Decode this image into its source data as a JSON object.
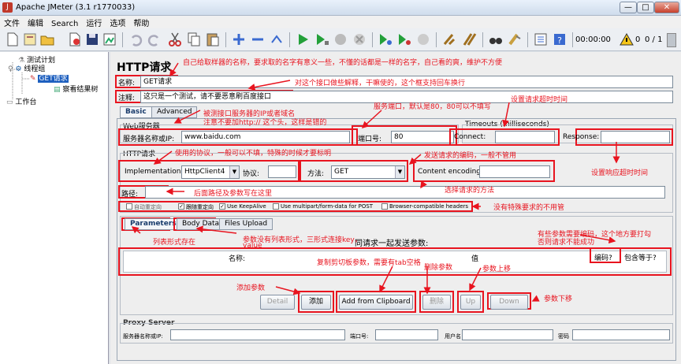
{
  "window": {
    "title": "Apache JMeter (3.1 r1770033)"
  },
  "menu": [
    "文件",
    "编辑",
    "Search",
    "运行",
    "选项",
    "帮助"
  ],
  "toolbar": {
    "time": "00:00:00",
    "warn_count": "0",
    "ratio": "0 / 1"
  },
  "tree": {
    "plan": "测试计划",
    "group": "线程组",
    "sampler": "GET请求",
    "listener": "察看结果树",
    "workbench": "工作台"
  },
  "http": {
    "title": "HTTP请求",
    "name_label": "名称:",
    "name_value": "GET请求",
    "comment_label": "注释:",
    "comment_value": "这只是一个测试，请不要恶意刷百度接口",
    "tab_basic": "Basic",
    "tab_advanced": "Advanced",
    "web_server": "Web服务器",
    "server_label": "服务器名称或IP:",
    "server_value": "www.baidu.com",
    "port_label": "端口号:",
    "port_value": "80",
    "timeouts_title": "Timeouts (milliseconds)",
    "connect_label": "Connect:",
    "response_label": "Response:",
    "http_request": "HTTP请求",
    "impl_label": "Implementation:",
    "impl_value": "HttpClient4",
    "protocol_label": "协议:",
    "method_label": "方法:",
    "method_value": "GET",
    "encoding_label": "Content encoding:",
    "path_label": "路径:",
    "options": [
      "自动重定向",
      "跟随重定向",
      "Use KeepAlive",
      "Use multipart/form-data for POST",
      "Browser-compatible headers"
    ],
    "sub_tabs": [
      "Parameters",
      "Body Data",
      "Files Upload"
    ],
    "send_params": "同请求一起发送参数:",
    "col_name": "名称:",
    "col_value": "值",
    "col_encode": "编码?",
    "col_include": "包含等于?",
    "buttons": {
      "detail": "Detail",
      "add": "添加",
      "clipboard": "Add from Clipboard",
      "delete": "删除",
      "up": "Up",
      "down": "Down"
    },
    "proxy_title": "Proxy Server",
    "proxy_server": "服务器名称或IP:",
    "proxy_port": "端口号:",
    "proxy_user": "用户名",
    "proxy_pass": "密码"
  },
  "notes": {
    "n1": "自己给取样器的名称，要求取的名字有意义一些，不懂的话都是一样的名字，自己看的爽，维护不方便",
    "n2": "对这个接口做些解释，干嘛使的，这个框支持回车换行",
    "n3": "被测接口服务器的IP或者域名",
    "n4": "注意不要加http:// 这个头，这样是错的",
    "n5": "服务端口，默认是80，80可以不填写",
    "n6": "设置请求超时时间",
    "n7": "设置响应超时时间",
    "n8": "使用的协议，一般可以不填，特殊的时候才要标明",
    "n9": "发送请求的编码，一般不管用",
    "n10": "后面路径及参数写在这里",
    "n11": "选择请求的方法",
    "n12": "没有特殊要求的不用管",
    "n13": "列表形式存在",
    "n14": "参数没有列表形式，三形式连接key，",
    "n14b": "value",
    "n15": "有些参数需要编码，这个地方要打勾",
    "n15b": "否则请求不能成功",
    "n16": "复制剪切板参数，需要有tab空格",
    "n17": "删除参数",
    "n18": "参数上移",
    "n19": "添加参数",
    "n20": "参数下移"
  }
}
